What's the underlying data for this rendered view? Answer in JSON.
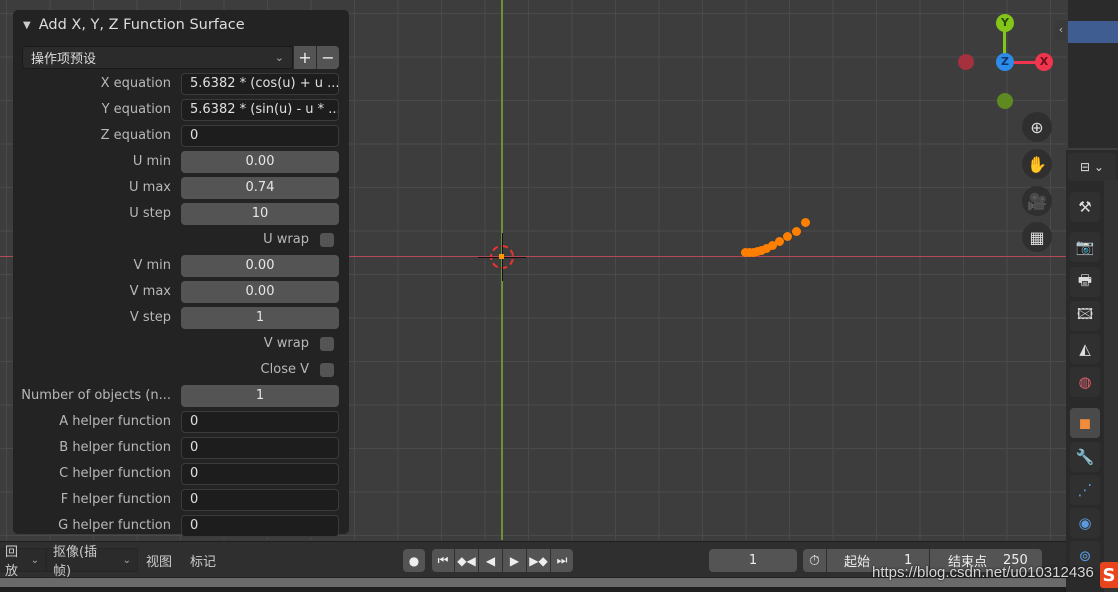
{
  "operator_panel": {
    "title": "Add X, Y, Z Function Surface",
    "preset_label": "操作项预设",
    "preset_add": "+",
    "preset_remove": "−",
    "fields": [
      {
        "label": "X equation",
        "value": "5.6382 * (cos(u) + u ...",
        "kind": "text"
      },
      {
        "label": "Y equation",
        "value": "5.6382 * (sin(u) - u * ...",
        "kind": "text"
      },
      {
        "label": "Z equation",
        "value": "0",
        "kind": "text"
      },
      {
        "label": "U min",
        "value": "0.00",
        "kind": "number"
      },
      {
        "label": "U max",
        "value": "0.74",
        "kind": "number"
      },
      {
        "label": "U step",
        "value": "10",
        "kind": "number"
      },
      {
        "label": "U wrap",
        "value": false,
        "kind": "checkbox"
      },
      {
        "label": "V min",
        "value": "0.00",
        "kind": "number"
      },
      {
        "label": "V max",
        "value": "0.00",
        "kind": "number"
      },
      {
        "label": "V step",
        "value": "1",
        "kind": "number"
      },
      {
        "label": "V wrap",
        "value": false,
        "kind": "checkbox"
      },
      {
        "label": "Close V",
        "value": false,
        "kind": "checkbox"
      },
      {
        "label": "Number of objects (n...",
        "value": "1",
        "kind": "number"
      },
      {
        "label": "A helper function",
        "value": "0",
        "kind": "text"
      },
      {
        "label": "B helper function",
        "value": "0",
        "kind": "text"
      },
      {
        "label": "C helper function",
        "value": "0",
        "kind": "text"
      },
      {
        "label": "F helper function",
        "value": "0",
        "kind": "text"
      },
      {
        "label": "G helper function",
        "value": "0",
        "kind": "text"
      }
    ]
  },
  "gizmo": {
    "y": "Y",
    "z": "Z",
    "x": "X",
    "colors": {
      "x": "#f0354e",
      "y": "#84c51a",
      "z": "#2e8ce8",
      "neg_x": "#a5303e",
      "neg_y": "#5f8a22"
    }
  },
  "nav_icons": [
    "zoom-icon",
    "pan-hand-icon",
    "camera-icon",
    "grid-icon"
  ],
  "timeline": {
    "playback_menu": "回放",
    "keying_menu": "抠像(插帧)",
    "view_menu": "视图",
    "marker_menu": "标记",
    "current_frame": "1",
    "start_label": "起始",
    "start_value": "1",
    "end_label": "结束点",
    "end_value": "250"
  },
  "watermark": "https://blog.csdn.net/u010312436",
  "logo_letter": "S",
  "accent_color": "#ff7f00"
}
